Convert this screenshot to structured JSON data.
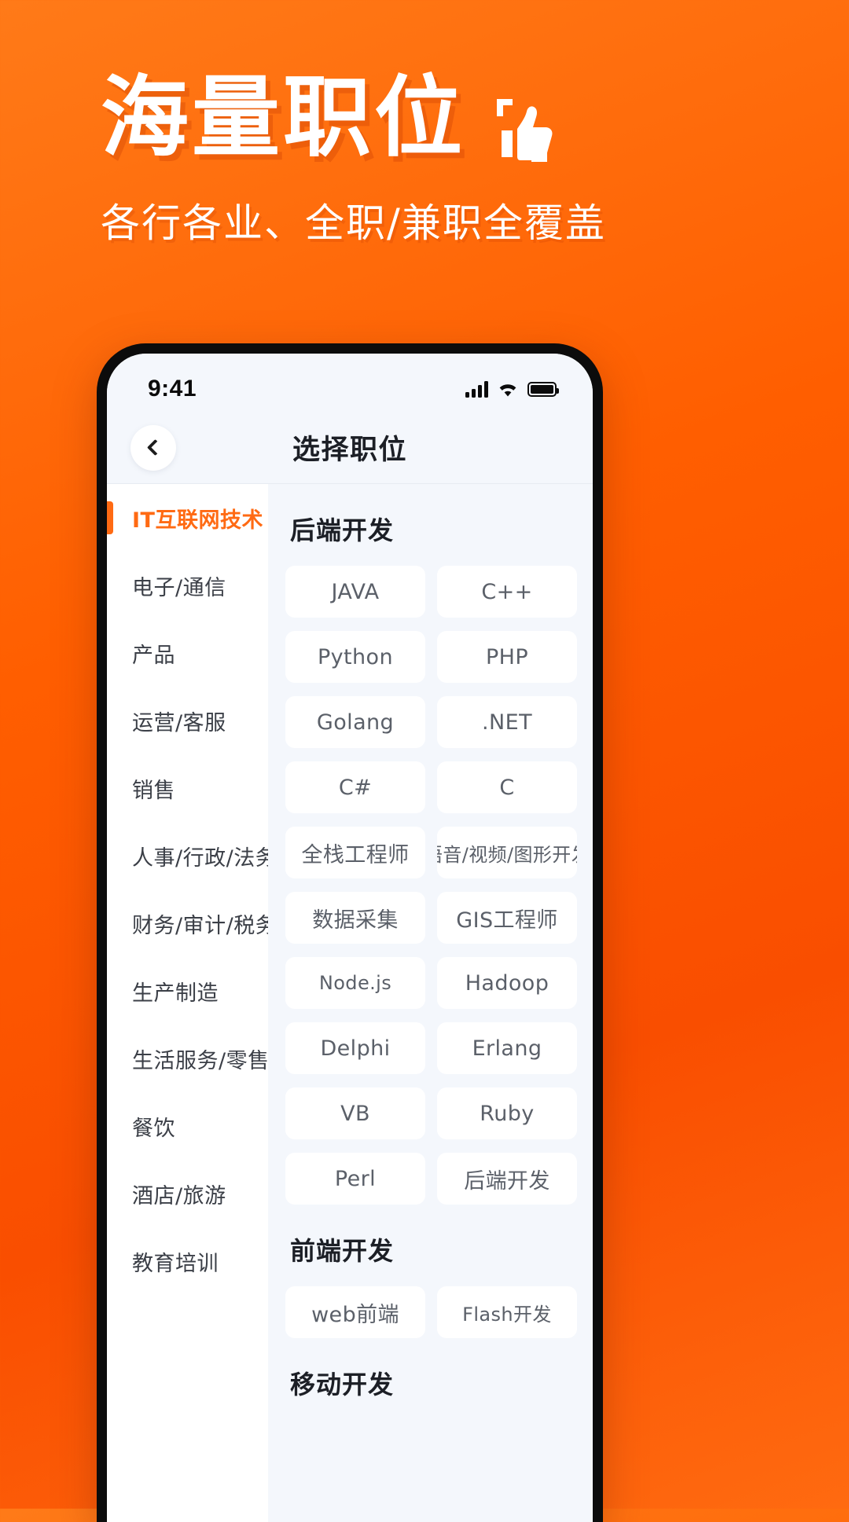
{
  "promo": {
    "headline": "海量职位",
    "subhead": "各行各业、全职/兼职全覆盖",
    "thumb_icon": "thumbs-up-icon",
    "background_color": "#FF5E00",
    "text_color": "#FFFFFF"
  },
  "phone": {
    "status_bar": {
      "time": "9:41",
      "signal_icon": "cellular-signal-icon",
      "wifi_icon": "wifi-icon",
      "battery_icon": "battery-full-icon"
    },
    "navbar": {
      "back_icon": "chevron-left-icon",
      "title": "选择职位"
    },
    "sidebar": {
      "active_index": 0,
      "active_color": "#FF6A13",
      "items": [
        {
          "label": "IT互联网技术"
        },
        {
          "label": "电子/通信"
        },
        {
          "label": "产品"
        },
        {
          "label": "运营/客服"
        },
        {
          "label": "销售"
        },
        {
          "label": "人事/行政/法务"
        },
        {
          "label": "财务/审计/税务"
        },
        {
          "label": "生产制造"
        },
        {
          "label": "生活服务/零售"
        },
        {
          "label": "餐饮"
        },
        {
          "label": "酒店/旅游"
        },
        {
          "label": "教育培训"
        }
      ]
    },
    "sections": [
      {
        "title": "后端开发",
        "tags": [
          "JAVA",
          "C++",
          "Python",
          "PHP",
          "Golang",
          ".NET",
          "C#",
          "C",
          "全栈工程师",
          "语音/视频/图形开发",
          "数据采集",
          "GIS工程师",
          "Node.js",
          "Hadoop",
          "Delphi",
          "Erlang",
          "VB",
          "Ruby",
          "Perl",
          "后端开发"
        ]
      },
      {
        "title": "前端开发",
        "tags": [
          "web前端",
          "Flash开发"
        ]
      },
      {
        "title": "移动开发",
        "tags": []
      }
    ]
  }
}
